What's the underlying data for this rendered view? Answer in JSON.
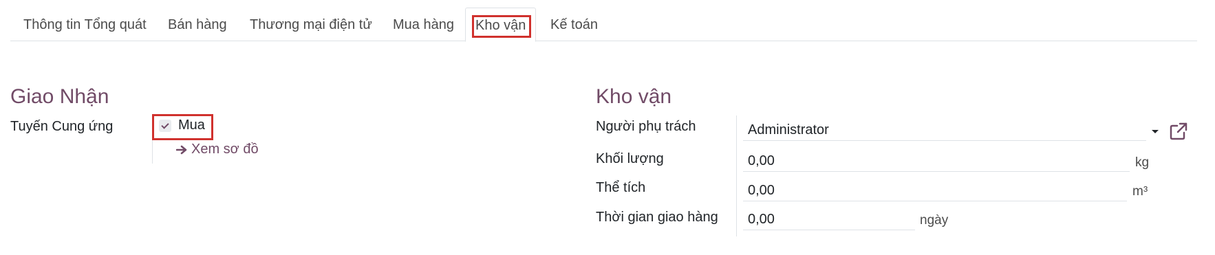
{
  "tabs": [
    {
      "label": "Thông tin Tổng quát"
    },
    {
      "label": "Bán hàng"
    },
    {
      "label": "Thương mại điện tử"
    },
    {
      "label": "Mua hàng"
    },
    {
      "label": "Kho vận",
      "active": true
    },
    {
      "label": "Kế toán"
    }
  ],
  "delivery": {
    "title": "Giao Nhận",
    "routes_label": "Tuyến Cung ứng",
    "routes": [
      {
        "label": "Mua",
        "checked": true
      }
    ],
    "diagram_link": "Xem sơ đồ"
  },
  "logistics": {
    "title": "Kho vận",
    "responsible_label": "Người phụ trách",
    "responsible_value": "Administrator",
    "weight_label": "Khối lượng",
    "weight_value": "0,00",
    "weight_unit": "kg",
    "volume_label": "Thể tích",
    "volume_value": "0,00",
    "volume_unit": "m³",
    "lead_time_label": "Thời gian giao hàng",
    "lead_time_value": "0,00",
    "lead_time_unit": "ngày"
  },
  "colors": {
    "accent": "#714b67",
    "highlight": "#d0312d"
  },
  "icons": {
    "checkbox": "check-icon",
    "link_arrow": "arrow-right-icon",
    "dropdown": "caret-down-icon",
    "external": "external-link-icon"
  }
}
